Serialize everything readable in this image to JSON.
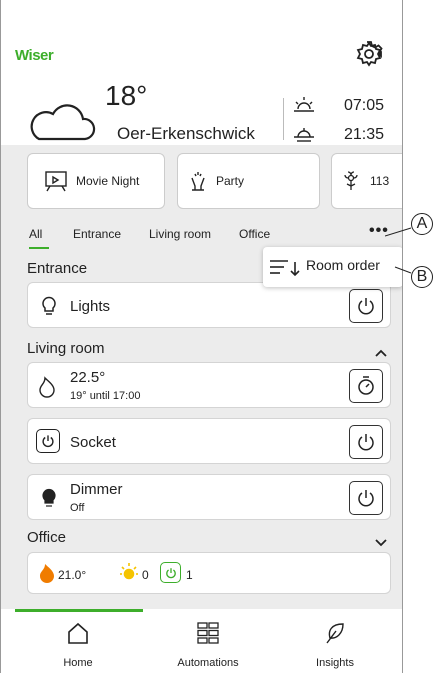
{
  "header": {
    "logo": "Wiser",
    "temperature": "18°",
    "city": "Oer-Erkenschwick",
    "sunrise": "07:05",
    "sunset": "21:35"
  },
  "scenes": [
    {
      "label": "Movie Night",
      "icon": "movie-night-icon"
    },
    {
      "label": "Party",
      "icon": "party-icon"
    },
    {
      "label": "113",
      "icon": "flower-icon"
    }
  ],
  "tabs": [
    "All",
    "Entrance",
    "Living room",
    "Office"
  ],
  "menu": {
    "room_order": "Room order"
  },
  "sections": {
    "entrance": "Entrance",
    "living_room": "Living room",
    "office": "Office"
  },
  "devices": {
    "lights": {
      "label": "Lights"
    },
    "thermostat": {
      "value": "22.5°",
      "sub": "19° until 17:00"
    },
    "socket": {
      "label": "Socket"
    },
    "dimmer": {
      "label": "Dimmer",
      "status": "Off"
    }
  },
  "office": {
    "temp": "21.0°",
    "lights_on": "0",
    "sockets_on": "1"
  },
  "nav": {
    "home": "Home",
    "automations": "Automations",
    "insights": "Insights"
  },
  "callouts": {
    "a": "A",
    "b": "B"
  },
  "colors": {
    "accent": "#3dae2b",
    "flame": "#f07c00",
    "sun": "#f5c400"
  }
}
